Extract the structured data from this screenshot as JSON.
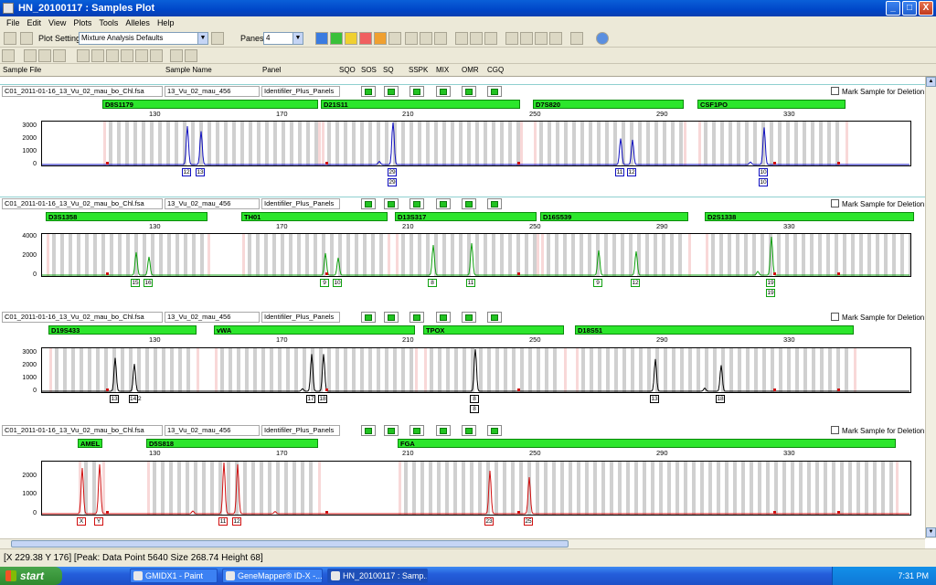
{
  "window": {
    "title": "HN_20100117 : Samples Plot",
    "min": "_",
    "max": "□",
    "close": "X"
  },
  "menu": [
    "File",
    "Edit",
    "View",
    "Plots",
    "Tools",
    "Alleles",
    "Help"
  ],
  "toolbar": {
    "plot_setting_label": "Plot Setting:",
    "plot_setting_value": "Mixture Analysis Defaults",
    "panes_label": "Panes:",
    "panes_value": "4"
  },
  "columns": [
    "Sample File",
    "Sample Name",
    "Panel",
    "SQO",
    "SOS",
    "SQ",
    "SSPK",
    "MIX",
    "OMR",
    "CGQ"
  ],
  "colors": {
    "blue": "#1010c0",
    "green": "#10a010",
    "black": "#000000",
    "red": "#d01010",
    "bin": "#c8c8c8",
    "pinkbin": "#f8d8d8"
  },
  "scale_ticks": [
    "130",
    "170",
    "210",
    "250",
    "290",
    "330"
  ],
  "panes": [
    {
      "sample_file": "C01_2011-01-16_13_Vu_02_mau_bo_Chl.fsa",
      "sample_name": "13_Vu_02_mau_456",
      "panel": "Identifiler_Plus_Panels",
      "mark_label": "Mark Sample for Deletion",
      "dye": "blue",
      "yticks": [
        "3000",
        "2000",
        "1000",
        "0"
      ],
      "loci": [
        {
          "name": "D8S1179"
        },
        {
          "name": "D21S11"
        },
        {
          "name": "D7S820"
        },
        {
          "name": "CSF1PO"
        }
      ],
      "alleles": [
        {
          "label": "12"
        },
        {
          "label": "13"
        },
        {
          "label": "29",
          "second": "29"
        },
        {
          "label": "11"
        },
        {
          "label": "12"
        },
        {
          "label": "10",
          "second": "10"
        }
      ]
    },
    {
      "sample_file": "C01_2011-01-16_13_Vu_02_mau_bo_Chl.fsa",
      "sample_name": "13_Vu_02_mau_456",
      "panel": "Identifiler_Plus_Panels",
      "mark_label": "Mark Sample for Deletion",
      "dye": "green",
      "yticks": [
        "4000",
        "2000",
        "0"
      ],
      "loci": [
        {
          "name": "D3S1358"
        },
        {
          "name": "TH01"
        },
        {
          "name": "D13S317"
        },
        {
          "name": "D16S539"
        },
        {
          "name": "D2S1338"
        }
      ],
      "alleles": [
        {
          "label": "15"
        },
        {
          "label": "16"
        },
        {
          "label": "9"
        },
        {
          "label": "10"
        },
        {
          "label": "8"
        },
        {
          "label": "11"
        },
        {
          "label": "9"
        },
        {
          "label": "12"
        },
        {
          "label": "19",
          "second": "19"
        }
      ]
    },
    {
      "sample_file": "C01_2011-01-16_13_Vu_02_mau_bo_Chl.fsa",
      "sample_name": "13_Vu_02_mau_456",
      "panel": "Identifiler_Plus_Panels",
      "mark_label": "Mark Sample for Deletion",
      "dye": "black",
      "yticks": [
        "3000",
        "2000",
        "1000",
        "0"
      ],
      "loci": [
        {
          "name": "D19S433"
        },
        {
          "name": "vWA"
        },
        {
          "name": "TPOX"
        },
        {
          "name": "D18S51"
        }
      ],
      "alleles": [
        {
          "label": "13"
        },
        {
          "label": "14.2"
        },
        {
          "label": "17"
        },
        {
          "label": "18"
        },
        {
          "label": "8",
          "second": "8"
        },
        {
          "label": "13"
        },
        {
          "label": "18"
        }
      ]
    },
    {
      "sample_file": "C01_2011-01-16_13_Vu_02_mau_bo_Chl.fsa",
      "sample_name": "13_Vu_02_mau_456",
      "panel": "Identifiler_Plus_Panels",
      "mark_label": "Mark Sample for Deletion",
      "dye": "red",
      "yticks": [
        "2000",
        "1000",
        "0"
      ],
      "loci": [
        {
          "name": "AMEL"
        },
        {
          "name": "D5S818"
        },
        {
          "name": "FGA"
        }
      ],
      "alleles": [
        {
          "label": "X"
        },
        {
          "label": "Y"
        },
        {
          "label": "11"
        },
        {
          "label": "12"
        },
        {
          "label": "23"
        },
        {
          "label": "25"
        }
      ]
    }
  ],
  "status": "[X 229.38  Y 176]  [Peak: Data Point 5640  Size 268.74  Height 68]",
  "taskbar": {
    "start": "start",
    "tasks": [
      "GMIDX1 - Paint",
      "GeneMapper® ID-X -...",
      "HN_20100117 : Samp..."
    ],
    "clock": "7:31 PM"
  }
}
